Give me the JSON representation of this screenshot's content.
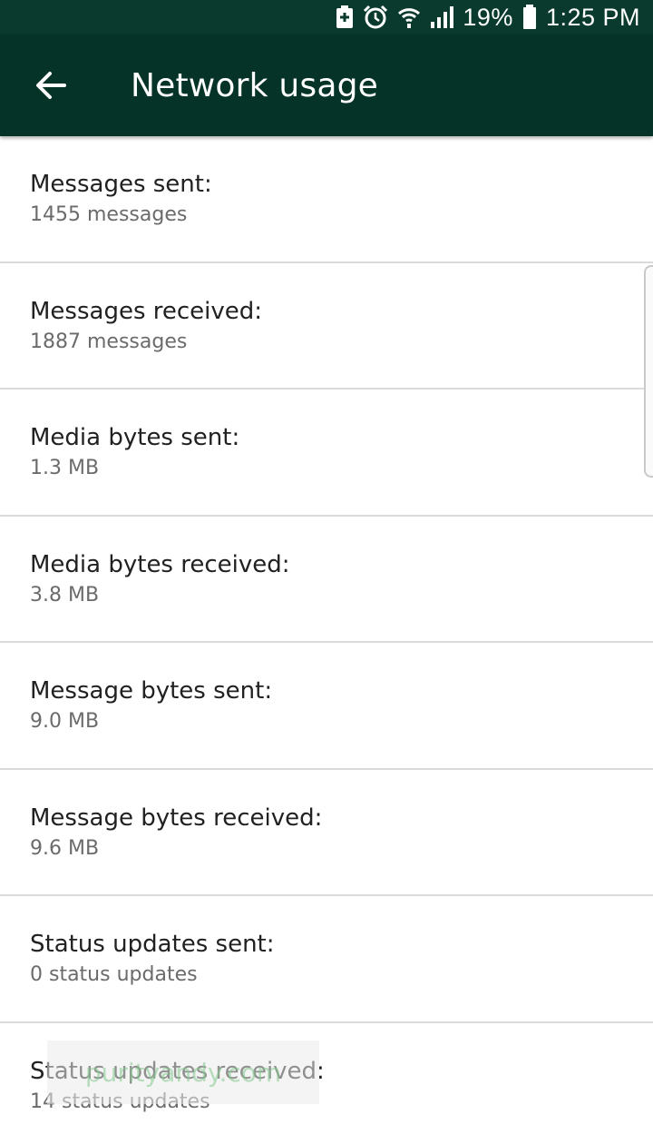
{
  "status_bar": {
    "battery_percent": "19%",
    "time": "1:25 PM",
    "icons": [
      "battery-saver-icon",
      "alarm-icon",
      "wifi-icon",
      "signal-icon",
      "battery-icon"
    ]
  },
  "app_bar": {
    "title": "Network usage",
    "back_icon": "arrow-back-icon"
  },
  "stats": [
    {
      "label": "Messages sent:",
      "value": "1455 messages"
    },
    {
      "label": "Messages received:",
      "value": "1887 messages"
    },
    {
      "label": "Media bytes sent:",
      "value": "1.3 MB"
    },
    {
      "label": "Media bytes received:",
      "value": "3.8 MB"
    },
    {
      "label": "Message bytes sent:",
      "value": "9.0 MB"
    },
    {
      "label": "Message bytes received:",
      "value": "9.6 MB"
    },
    {
      "label": "Status updates sent:",
      "value": "0 status updates"
    },
    {
      "label": "Status updates received:",
      "value": "14 status updates"
    }
  ],
  "watermark": "purityandy.com",
  "colors": {
    "app_bar": "#063328",
    "status_bar": "#0a3a2d",
    "label_text": "#212121",
    "value_text": "#6b6b6b",
    "divider": "#dadada"
  }
}
